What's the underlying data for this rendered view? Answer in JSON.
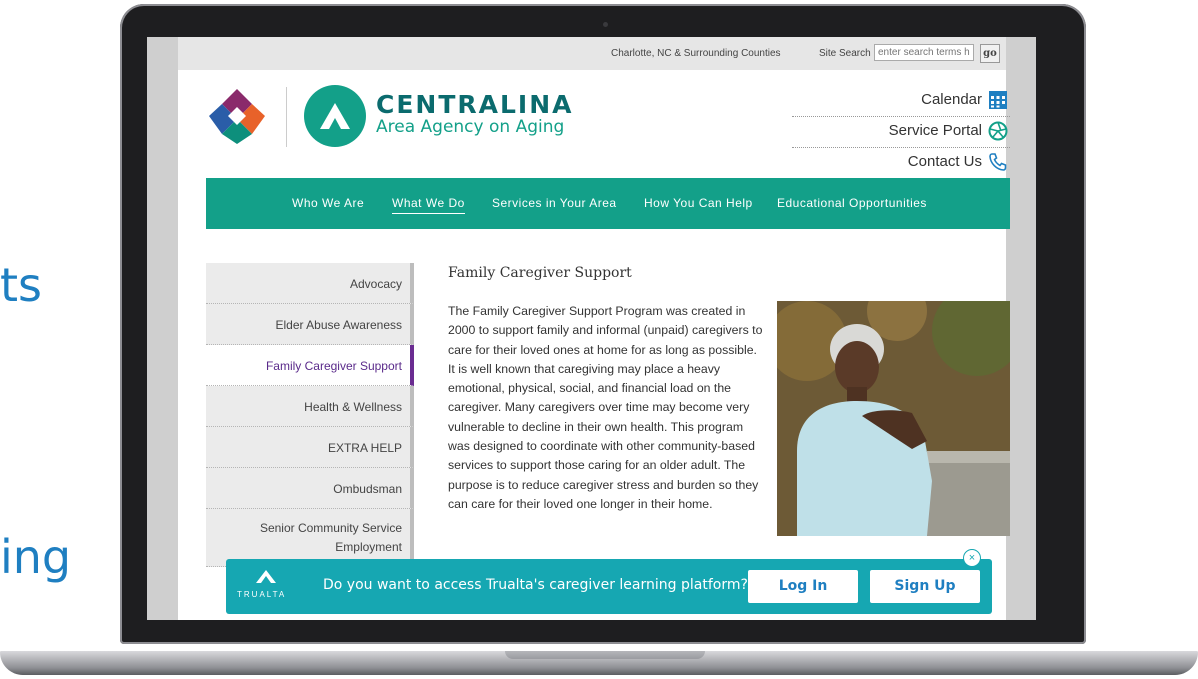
{
  "background": {
    "word_top": "ts",
    "word_bottom": "ing",
    "color": "#1f7fc1"
  },
  "topbar": {
    "location": "Charlotte, NC & Surrounding Counties",
    "site_search_label": "Site Search",
    "search_placeholder": "enter search terms h",
    "go_label": "go"
  },
  "brand": {
    "name": "CENTRALINA",
    "subtitle": "Area Agency on Aging",
    "color": "#13a089"
  },
  "utility_links": [
    {
      "label": "Calendar",
      "icon": "calendar-icon"
    },
    {
      "label": "Service Portal",
      "icon": "aperture-icon"
    },
    {
      "label": "Contact Us",
      "icon": "phone-icon"
    }
  ],
  "nav": {
    "items": [
      "Who We Are",
      "What We Do",
      "Services in Your Area",
      "How You Can Help",
      "Educational Opportunities"
    ],
    "active": "What We Do"
  },
  "sidenav": {
    "items": [
      "Advocacy",
      "Elder Abuse Awareness",
      "Family Caregiver Support",
      "Health & Wellness",
      "EXTRA HELP",
      "Ombudsman",
      "Senior Community Service Employment"
    ],
    "active": "Family Caregiver Support",
    "active_color": "#6a2c91"
  },
  "content": {
    "title": "Family Caregiver Support",
    "body": "The Family Caregiver Support Program was created in 2000 to support family and informal (unpaid) caregivers to care for their loved ones at home for as long as possible.  It is well known that caregiving may place a heavy emotional, physical, social, and financial load on the caregiver. Many caregivers over time may become very vulnerable to decline in their own health.  This program was designed to coordinate with other community-based services to support those caring for an older adult.  The purpose is to reduce caregiver stress and burden so they can care for their loved one longer in their home."
  },
  "banner": {
    "brand": "TRUALTA",
    "message": "Do you want to access Trualta's caregiver learning platform?",
    "login_label": "Log In",
    "signup_label": "Sign Up",
    "close_label": "×",
    "color": "#16a7b2"
  }
}
